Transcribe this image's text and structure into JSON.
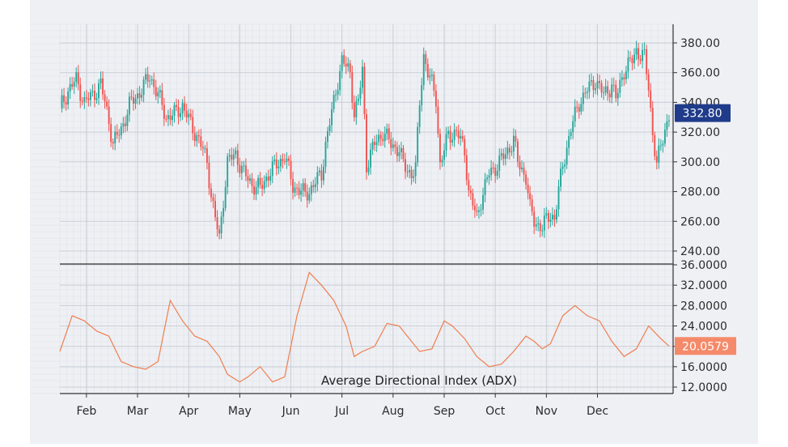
{
  "colors": {
    "background": "#eef0f4",
    "grid_minor": "#dde1e8",
    "grid_major": "#c9ced6",
    "up": "#26a69a",
    "down": "#ef5350",
    "axis": "#333333",
    "price_badge": "#1f3b8a",
    "adx_line": "#f07e4f",
    "adx_badge": "#f58a6a"
  },
  "price_panel": {
    "y_ticks": [
      "380.00",
      "360.00",
      "340.00",
      "320.00",
      "300.00",
      "280.00",
      "260.00",
      "240.00"
    ],
    "last_price_label": "332.80"
  },
  "adx_panel": {
    "title": "Average Directional Index (ADX)",
    "y_ticks": [
      "36.0000",
      "32.0000",
      "28.0000",
      "24.0000",
      "20.0000",
      "16.0000",
      "12.0000"
    ],
    "last_value_label": "20.0579"
  },
  "x_axis": {
    "months": [
      "Feb",
      "Mar",
      "Apr",
      "May",
      "Jun",
      "Jul",
      "Aug",
      "Sep",
      "Oct",
      "Nov",
      "Dec"
    ]
  },
  "chart_data": [
    {
      "type": "candlestick",
      "name": "",
      "ylim": [
        237,
        390
      ],
      "close_path": [
        [
          0,
          336
        ],
        [
          4,
          348
        ],
        [
          8,
          355
        ],
        [
          12,
          340
        ],
        [
          16,
          345
        ],
        [
          20,
          352
        ],
        [
          24,
          328
        ],
        [
          26,
          312
        ],
        [
          30,
          322
        ],
        [
          34,
          338
        ],
        [
          38,
          345
        ],
        [
          42,
          353
        ],
        [
          44,
          358
        ],
        [
          48,
          345
        ],
        [
          52,
          330
        ],
        [
          56,
          332
        ],
        [
          60,
          338
        ],
        [
          64,
          325
        ],
        [
          68,
          315
        ],
        [
          72,
          300
        ],
        [
          74,
          278
        ],
        [
          76,
          262
        ],
        [
          78,
          248
        ],
        [
          80,
          275
        ],
        [
          82,
          300
        ],
        [
          86,
          305
        ],
        [
          90,
          292
        ],
        [
          94,
          285
        ],
        [
          98,
          282
        ],
        [
          102,
          292
        ],
        [
          106,
          298
        ],
        [
          110,
          304
        ],
        [
          114,
          284
        ],
        [
          118,
          280
        ],
        [
          120,
          278
        ],
        [
          124,
          284
        ],
        [
          128,
          292
        ],
        [
          130,
          312
        ],
        [
          134,
          340
        ],
        [
          136,
          355
        ],
        [
          138,
          368
        ],
        [
          142,
          360
        ],
        [
          144,
          333
        ],
        [
          146,
          340
        ],
        [
          148,
          362
        ],
        [
          150,
          298
        ],
        [
          154,
          312
        ],
        [
          158,
          320
        ],
        [
          162,
          312
        ],
        [
          166,
          308
        ],
        [
          168,
          298
        ],
        [
          172,
          292
        ],
        [
          174,
          295
        ],
        [
          176,
          340
        ],
        [
          178,
          372
        ],
        [
          180,
          360
        ],
        [
          182,
          352
        ],
        [
          184,
          343
        ],
        [
          186,
          298
        ],
        [
          190,
          318
        ],
        [
          194,
          320
        ],
        [
          198,
          308
        ],
        [
          200,
          280
        ],
        [
          204,
          262
        ],
        [
          206,
          275
        ],
        [
          210,
          292
        ],
        [
          214,
          298
        ],
        [
          218,
          305
        ],
        [
          222,
          315
        ],
        [
          224,
          300
        ],
        [
          228,
          290
        ],
        [
          230,
          268
        ],
        [
          232,
          260
        ],
        [
          236,
          256
        ],
        [
          240,
          265
        ],
        [
          242,
          262
        ],
        [
          246,
          298
        ],
        [
          250,
          322
        ],
        [
          254,
          340
        ],
        [
          258,
          348
        ],
        [
          262,
          355
        ],
        [
          266,
          345
        ],
        [
          270,
          352
        ],
        [
          272,
          342
        ],
        [
          276,
          362
        ],
        [
          280,
          368
        ],
        [
          282,
          375
        ],
        [
          286,
          370
        ],
        [
          288,
          350
        ],
        [
          290,
          320
        ],
        [
          292,
          298
        ],
        [
          296,
          322
        ],
        [
          298,
          332
        ]
      ]
    },
    {
      "type": "line",
      "name": "",
      "ylim": [
        11,
        36
      ],
      "x": [
        0,
        6,
        12,
        18,
        24,
        30,
        36,
        42,
        48,
        54,
        60,
        66,
        72,
        78,
        82,
        88,
        92,
        98,
        104,
        110,
        116,
        122,
        128,
        134,
        140,
        144,
        148,
        154,
        160,
        166,
        170,
        176,
        182,
        188,
        192,
        198,
        204,
        210,
        216,
        222,
        228,
        232,
        236,
        240,
        246,
        252,
        258,
        264,
        270,
        276,
        282,
        288,
        294,
        298
      ],
      "values": [
        19,
        26,
        25,
        23,
        22,
        17,
        16,
        15.5,
        17,
        29,
        25,
        22,
        21,
        18,
        14.5,
        13,
        14,
        16,
        13,
        14,
        26,
        34.5,
        32,
        29,
        24,
        18,
        19,
        20,
        24.5,
        24,
        22,
        19,
        19.5,
        25,
        24,
        21.5,
        18,
        16,
        16.5,
        19,
        22,
        21,
        19.5,
        20.5,
        26,
        28,
        26,
        25,
        21,
        18,
        19.5,
        24,
        21.5,
        20.0579
      ]
    }
  ]
}
